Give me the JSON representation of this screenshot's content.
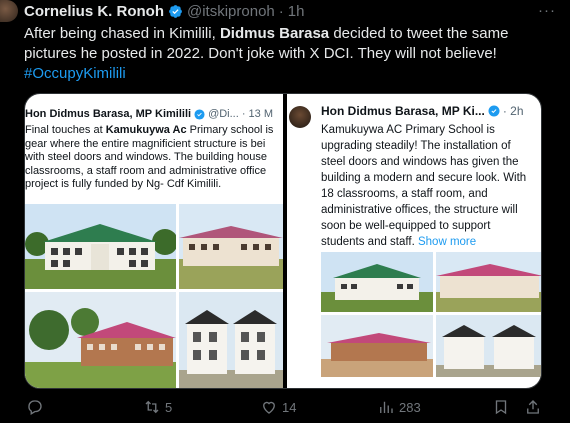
{
  "tweet": {
    "author_name": "Cornelius K. Ronoh",
    "author_handle": "@itskipronoh",
    "separator": "·",
    "time": "1h",
    "more_label": "···",
    "text_part1": "After being chased in Kimilili, ",
    "text_bold": "Didmus Barasa",
    "text_part2": " decided to tweet the same pictures he posted in 2022. Don't joke with X DCI. They will not believe!",
    "hashtag": "#OccupyKimilili"
  },
  "left_screenshot": {
    "author_name": "Hon Didmus Barasa, MP Kimilili",
    "handle_date": "@Di...  · 13 M",
    "line1_a": "Final touches at ",
    "line1_bold": "Kamukuywa  Ac",
    "line1_b": " Primary school is",
    "line2": "gear where the entire magnificient structure is bei",
    "line3": "with steel doors and windows. The building house",
    "line4": "classrooms,  a staff room and administrative office",
    "line5": "project is fully funded by Ng- Cdf Kimilili."
  },
  "right_screenshot": {
    "author_name": "Hon Didmus Barasa, MP Ki...",
    "time": "· 2h",
    "body": "Kamukuywa AC Primary School is upgrading steadily! The installation of steel doors and windows has given the building a modern and secure look. With 18 classrooms, a staff room, and administrative offices, the structure will soon be well-equipped to support students and staff.",
    "show_more": "Show more"
  },
  "actions": {
    "replies": "",
    "reposts": "5",
    "likes": "14",
    "views": "283"
  },
  "colors": {
    "accent": "#1d9bf0",
    "background": "#000000",
    "muted": "#71767b",
    "roof_green": "#2e7d4f",
    "roof_pink": "#c2497a"
  }
}
